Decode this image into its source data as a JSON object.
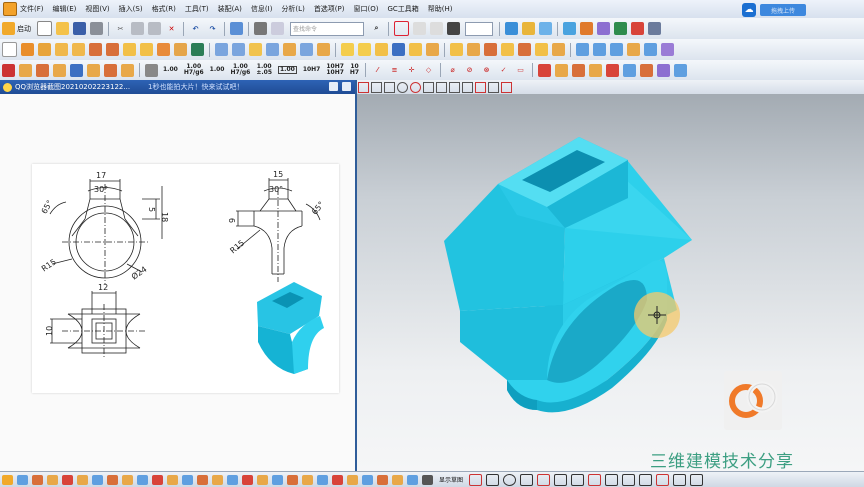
{
  "menubar": {
    "items": [
      "文件(F)",
      "编辑(E)",
      "视图(V)",
      "插入(S)",
      "格式(R)",
      "工具(T)",
      "装配(A)",
      "信息(I)",
      "分析(L)",
      "首选项(P)",
      "窗口(O)",
      "GC工具箱",
      "帮助(H)"
    ]
  },
  "toolbar": {
    "start_label": "启动",
    "search_placeholder": "查找命令",
    "fit_labels": [
      "1.00",
      "1.00\nH7/g6",
      "1.00",
      "1.00\nH7/g6",
      "1.00\n±.05",
      "1.00",
      "10H7",
      "10H7\n10H7",
      "10\nH7"
    ]
  },
  "upload": {
    "label": "拖拽上传"
  },
  "viewer": {
    "title": "QQ浏览器截图20210202223122...",
    "hint": "1秒也能拍大片！快来试试吧！"
  },
  "drawing": {
    "dims": {
      "top_width": "17",
      "top_angle": "30°",
      "left_angle": "65°",
      "height_5": "5",
      "height_18": "18",
      "radius_left": "R15",
      "diameter": "Ø24",
      "side_width": "15",
      "side_angle": "30°",
      "side_9": "9",
      "side_65": "65°",
      "side_r15": "R15",
      "bottom_12": "12",
      "bottom_10": "10"
    }
  },
  "watermark": {
    "text": "三维建模技术分享"
  },
  "statusbar": {
    "sketch_label": "显示草图"
  },
  "colors": {
    "model": "#22c3e0",
    "model_dark": "#0f9fbf",
    "cursor_glow": "#f4c96b"
  }
}
